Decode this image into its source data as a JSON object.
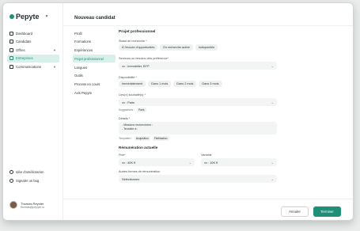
{
  "app": {
    "logo": "Pepyte",
    "page_title": "Nouveau candidat"
  },
  "sidebar": {
    "items": [
      {
        "label": "Dashboard",
        "icon": "dashboard-icon"
      },
      {
        "label": "Candidats",
        "icon": "users-icon"
      },
      {
        "label": "Offres",
        "icon": "briefcase-icon"
      },
      {
        "label": "Entreprises",
        "icon": "building-icon"
      },
      {
        "label": "Communications",
        "icon": "chat-icon"
      }
    ],
    "bottom": [
      {
        "label": "Idée d'améliorarion",
        "icon": "lightbulb-icon"
      },
      {
        "label": "Signaler un bug",
        "icon": "bug-icon"
      }
    ],
    "user": {
      "name": "Thomas Reynier",
      "email": "thomas@pepyte.io"
    }
  },
  "steps": [
    "Profil",
    "Formations",
    "Expériences",
    "Projet professionnel",
    "Langues",
    "Outils",
    "Process en cours",
    "Avis Pepyte"
  ],
  "form": {
    "section_title": "Projet professionnel",
    "statut_label": "Statut de recherche *",
    "statut_options": [
      "À l'écoute d'opportunités",
      "En recherche active",
      "Indisponible"
    ],
    "secteurs_label": "Secteurs ou besoins clés préférence*",
    "secteurs_value": "xx : Immobilier, BTP",
    "dispo_label": "Disponibilité *",
    "dispo_options": [
      "Immédiatement",
      "Dans 1 mois",
      "Dans 2 mois",
      "Dans 3 mois"
    ],
    "lieux_label": "Lieu(x) souhaité(s) *",
    "lieux_value": "xx : Paris",
    "suggestions_label": "Suggestions :",
    "suggestion": "Paris",
    "details_label": "Détails *",
    "details_lines": [
      "- Missions recherchées :",
      "- Tensible à :"
    ],
    "templates_label": "Templates :",
    "templates": [
      "Acquisition",
      "Fidélisation"
    ],
    "remuneration_title": "Rémunération actuelle",
    "fixe_label": "Fixe*",
    "fixe_value": "xx : 40K €",
    "variable_label": "Variable",
    "variable_value": "xx : 10K €",
    "avantages_label": "Autres formes de rémunération",
    "avantages_value": "Sélectionnez"
  },
  "footer": {
    "cancel": "Annuler",
    "finish": "Terminer"
  }
}
